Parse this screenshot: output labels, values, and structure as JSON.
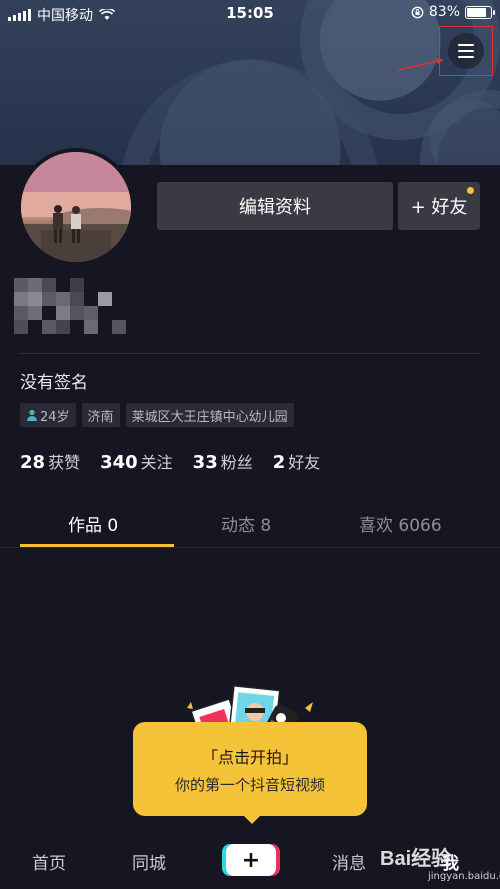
{
  "status_bar": {
    "carrier": "中国移动",
    "time": "15:05",
    "battery": "83%",
    "battery_level": 0.83
  },
  "header": {
    "menu_icon": "hamburger-menu-icon"
  },
  "profile": {
    "edit_button": "编辑资料",
    "add_friend_button": "+ 好友",
    "signature": "没有签名",
    "tags": {
      "age": "24岁",
      "city": "济南",
      "school": "莱城区大王庄镇中心幼儿园"
    },
    "stats": [
      {
        "num": "28",
        "label": "获赞"
      },
      {
        "num": "340",
        "label": "关注"
      },
      {
        "num": "33",
        "label": "粉丝"
      },
      {
        "num": "2",
        "label": "好友"
      }
    ]
  },
  "tabs": [
    {
      "label": "作品 0"
    },
    {
      "label": "动态 8"
    },
    {
      "label": "喜欢 6066"
    }
  ],
  "empty_prompt": {
    "title": "「点击开拍」",
    "subtitle": "你的第一个抖音短视频"
  },
  "bottom_nav": {
    "home": "首页",
    "nearby": "同城",
    "plus": "+",
    "messages": "消息",
    "me": "我"
  },
  "watermark": {
    "brand": "Bai经验",
    "url": "jingyan.baidu.com"
  },
  "colors": {
    "background": "#161622",
    "accent": "#f5c338",
    "button_bg": "#393a44",
    "highlight_box": "#e03030"
  }
}
